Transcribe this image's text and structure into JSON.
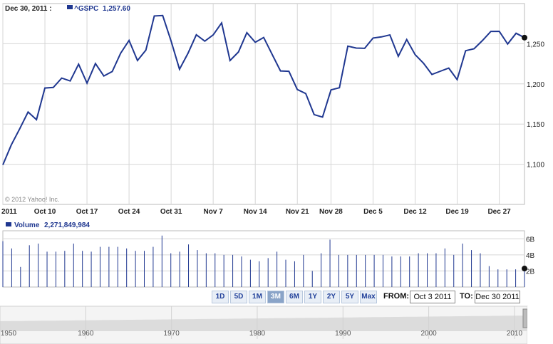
{
  "header": {
    "date": "Dec 30, 2011 :",
    "symbol": "^GSPC",
    "price": "1,257.60"
  },
  "copyright": "© 2012 Yahoo! Inc.",
  "volume_header": {
    "label": "Volume",
    "value": "2,271,849,984"
  },
  "colors": {
    "line": "#1f3790",
    "grid": "#d6d6d6",
    "axis_text": "#222222",
    "navigator_fill": "#dcdcdc"
  },
  "chart_data": [
    {
      "type": "line",
      "title": "",
      "series": [
        {
          "name": "^GSPC",
          "x": [
            "2011-10-03",
            "2011-10-04",
            "2011-10-05",
            "2011-10-06",
            "2011-10-07",
            "2011-10-10",
            "2011-10-11",
            "2011-10-12",
            "2011-10-13",
            "2011-10-14",
            "2011-10-17",
            "2011-10-18",
            "2011-10-19",
            "2011-10-20",
            "2011-10-21",
            "2011-10-24",
            "2011-10-25",
            "2011-10-26",
            "2011-10-27",
            "2011-10-28",
            "2011-10-31",
            "2011-11-01",
            "2011-11-02",
            "2011-11-03",
            "2011-11-04",
            "2011-11-07",
            "2011-11-08",
            "2011-11-09",
            "2011-11-10",
            "2011-11-11",
            "2011-11-14",
            "2011-11-15",
            "2011-11-16",
            "2011-11-17",
            "2011-11-18",
            "2011-11-21",
            "2011-11-22",
            "2011-11-23",
            "2011-11-25",
            "2011-11-28",
            "2011-11-29",
            "2011-11-30",
            "2011-12-01",
            "2011-12-02",
            "2011-12-05",
            "2011-12-06",
            "2011-12-07",
            "2011-12-08",
            "2011-12-09",
            "2011-12-12",
            "2011-12-13",
            "2011-12-14",
            "2011-12-15",
            "2011-12-16",
            "2011-12-19",
            "2011-12-20",
            "2011-12-21",
            "2011-12-22",
            "2011-12-23",
            "2011-12-27",
            "2011-12-28",
            "2011-12-29",
            "2011-12-30"
          ],
          "values": [
            1099.23,
            1123.95,
            1144.03,
            1164.97,
            1155.46,
            1194.89,
            1195.54,
            1207.25,
            1203.66,
            1224.58,
            1200.86,
            1225.38,
            1209.88,
            1215.39,
            1238.25,
            1254.19,
            1229.05,
            1242.0,
            1284.59,
            1285.09,
            1253.3,
            1218.28,
            1237.9,
            1261.15,
            1253.23,
            1261.12,
            1275.92,
            1229.1,
            1239.7,
            1263.85,
            1251.78,
            1257.81,
            1236.91,
            1216.13,
            1215.65,
            1192.98,
            1188.04,
            1161.79,
            1158.67,
            1192.55,
            1195.19,
            1246.96,
            1244.58,
            1244.28,
            1257.08,
            1258.47,
            1261.01,
            1234.35,
            1255.19,
            1236.47,
            1225.73,
            1211.82,
            1215.75,
            1219.66,
            1205.35,
            1241.3,
            1243.72,
            1254.0,
            1265.33,
            1265.43,
            1249.64,
            1263.02,
            1257.6
          ]
        }
      ],
      "ylim": [
        1050,
        1300
      ],
      "y_ticks": [
        "1,100",
        "1,150",
        "1,200",
        "1,250"
      ],
      "x_ticks": [
        "2011",
        "Oct 10",
        "Oct 17",
        "Oct 24",
        "Oct 31",
        "Nov 7",
        "Nov 14",
        "Nov 21",
        "Nov 28",
        "Dec 5",
        "Dec 12",
        "Dec 19",
        "Dec 27"
      ],
      "grid": true
    },
    {
      "type": "bar",
      "title": "",
      "series": [
        {
          "name": "Volume",
          "values": [
            5.7,
            4.8,
            2.5,
            5.2,
            5.4,
            4.4,
            4.4,
            4.5,
            5.4,
            4.5,
            4.4,
            5.0,
            5.0,
            5.0,
            4.8,
            4.5,
            4.5,
            5.0,
            6.4,
            4.2,
            4.4,
            5.3,
            4.6,
            4.2,
            4.2,
            4.0,
            4.0,
            3.8,
            3.4,
            3.2,
            3.6,
            4.4,
            3.4,
            3.2,
            4.0,
            2.0,
            4.2,
            5.9,
            4.0,
            4.0,
            4.0,
            4.0,
            4.0,
            4.0,
            3.8,
            3.8,
            3.8,
            4.2,
            4.2,
            4.2,
            4.8,
            4.0,
            5.4,
            4.6,
            4.2,
            2.6,
            2.2,
            2.2,
            2.2,
            2.3
          ]
        }
      ],
      "y_ticks": [
        "6B",
        "4B",
        "2B"
      ],
      "units": "B"
    }
  ],
  "range_buttons": [
    "1D",
    "5D",
    "1M",
    "3M",
    "6M",
    "1Y",
    "2Y",
    "5Y",
    "Max"
  ],
  "active_range": "3M",
  "from_label": "FROM:",
  "from_value": "Oct 3 2011",
  "to_label": "TO:",
  "to_value": "Dec 30 2011",
  "navigator": {
    "labels": [
      "1950",
      "1960",
      "1970",
      "1980",
      "1990",
      "2000",
      "2010"
    ]
  }
}
